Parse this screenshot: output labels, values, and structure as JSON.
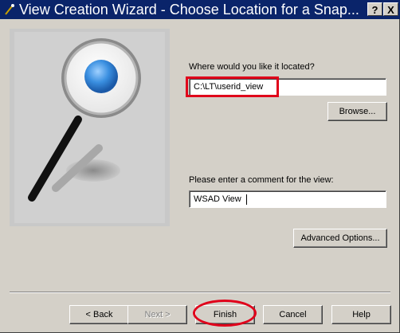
{
  "titlebar": {
    "title": "View Creation Wizard - Choose Location for a Snap...",
    "help_label": "?",
    "close_label": "X"
  },
  "location": {
    "prompt": "Where would you like it located?",
    "value": "C:\\LT\\userid_view",
    "browse_label": "Browse..."
  },
  "comment": {
    "prompt": "Please enter a comment for the view:",
    "value": "WSAD View"
  },
  "advanced_label": "Advanced Options...",
  "footer": {
    "back_label": "< Back",
    "next_label": "Next >",
    "finish_label": "Finish",
    "cancel_label": "Cancel",
    "help_label": "Help"
  },
  "colors": {
    "titlebar": "#0a246a",
    "highlight": "#e0001a",
    "dialog": "#d4d0c8"
  },
  "icons": {
    "title": "wizard-wand-icon",
    "art": "magnifying-glass-illustration"
  }
}
